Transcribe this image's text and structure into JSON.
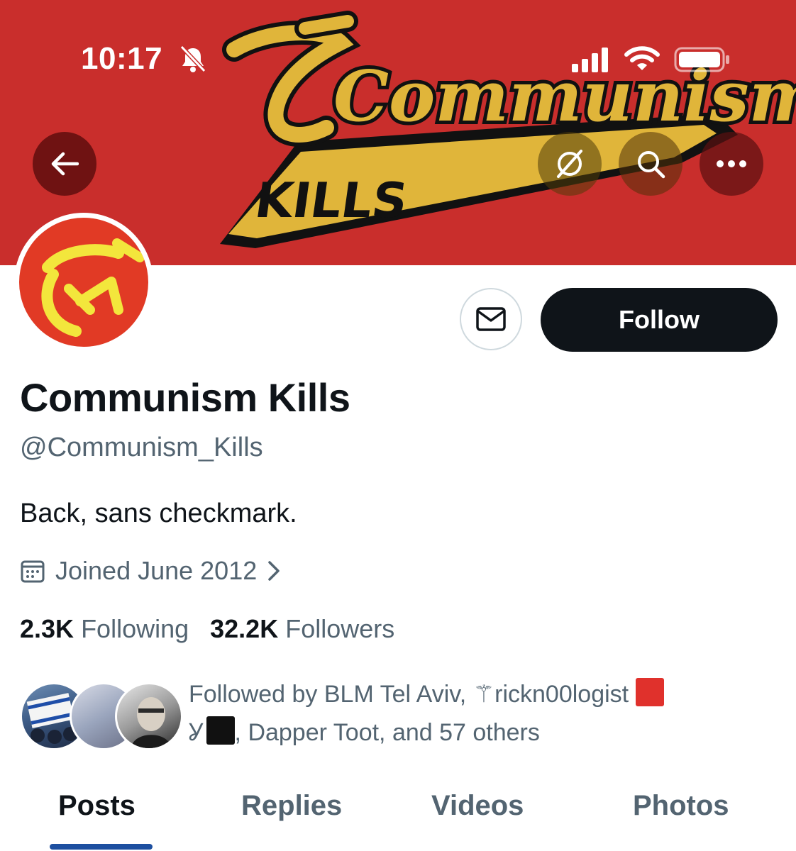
{
  "status_bar": {
    "time": "10:17"
  },
  "banner": {
    "art_word_1": "Communism",
    "art_word_2": "KILLS"
  },
  "profile": {
    "name": "Communism Kills",
    "handle": "@Communism_Kills",
    "bio": "Back, sans checkmark.",
    "joined": "Joined June 2012"
  },
  "actions": {
    "follow_label": "Follow"
  },
  "stats": {
    "following_count": "2.3K",
    "following_label": "Following",
    "followers_count": "32.2K",
    "followers_label": "Followers"
  },
  "followed_by": {
    "prefix": "Followed by BLM Tel Aviv, ",
    "name2": "rickn00logist",
    "joiner": ", Dapper Toot, and 57 others"
  },
  "tabs": [
    {
      "label": "Posts",
      "active": true
    },
    {
      "label": "Replies",
      "active": false
    },
    {
      "label": "Videos",
      "active": false
    },
    {
      "label": "Photos",
      "active": false
    }
  ],
  "colors": {
    "banner_red": "#c92e2c",
    "logo_gold": "#e0b53a",
    "follow_bg": "#0f1419",
    "tab_indicator": "#1d4fa0"
  },
  "icons": [
    "back-arrow-icon",
    "grok-icon",
    "search-icon",
    "more-icon",
    "bell-muted-icon",
    "signal-icon",
    "wifi-icon",
    "battery-icon",
    "mail-icon",
    "calendar-icon",
    "chevron-right-icon"
  ]
}
